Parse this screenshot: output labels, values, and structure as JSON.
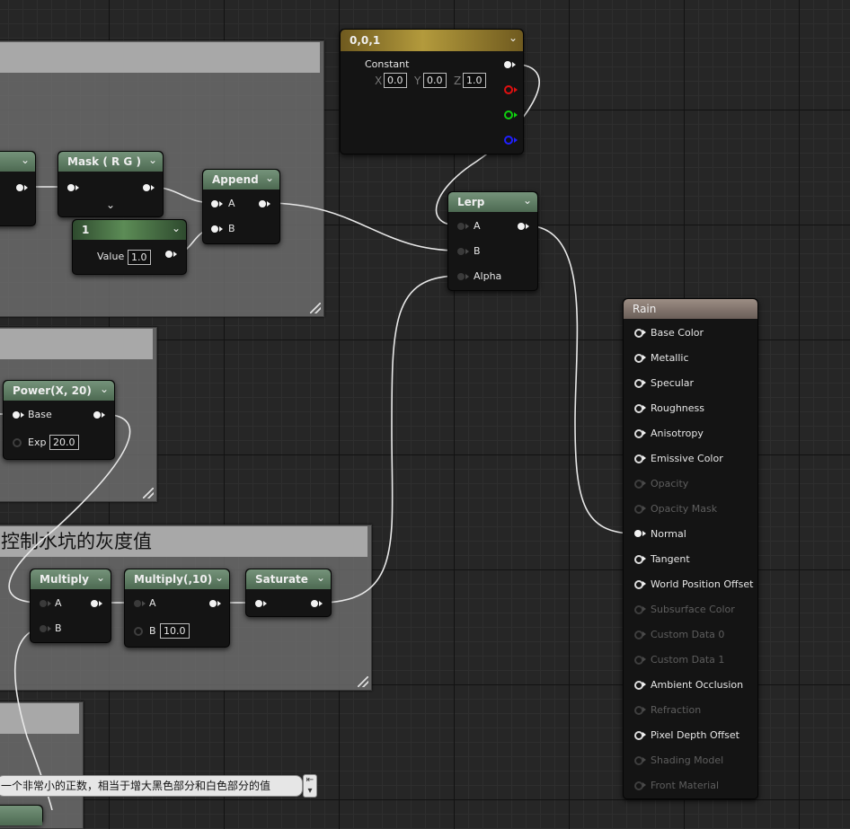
{
  "comments": {
    "c4_title": "控制水坑的灰度值"
  },
  "nodes": {
    "constant3": {
      "title": "0,0,1",
      "label": "Constant",
      "x_label": "X",
      "x_value": "0.0",
      "y_label": "Y",
      "y_value": "0.0",
      "z_label": "Z",
      "z_value": "1.0"
    },
    "mask": {
      "title": "Mask ( R G )"
    },
    "append": {
      "title": "Append",
      "pin_a": "A",
      "pin_b": "B"
    },
    "scalar1": {
      "title": "1",
      "value_label": "Value",
      "value": "1.0"
    },
    "lerp": {
      "title": "Lerp",
      "pin_a": "A",
      "pin_b": "B",
      "pin_alpha": "Alpha"
    },
    "power": {
      "title": "Power(X, 20)",
      "pin_base": "Base",
      "pin_exp": "Exp",
      "exp_value": "20.0"
    },
    "multiply1": {
      "title": "Multiply",
      "pin_a": "A",
      "pin_b": "B"
    },
    "multiply2": {
      "title": "Multiply(,10)",
      "pin_a": "A",
      "pin_b": "B",
      "b_value": "10.0"
    },
    "saturate": {
      "title": "Saturate"
    },
    "rain": {
      "title": "Rain",
      "pins": [
        {
          "label": "Base Color",
          "active": true
        },
        {
          "label": "Metallic",
          "active": true
        },
        {
          "label": "Specular",
          "active": true
        },
        {
          "label": "Roughness",
          "active": true
        },
        {
          "label": "Anisotropy",
          "active": true
        },
        {
          "label": "Emissive Color",
          "active": true
        },
        {
          "label": "Opacity",
          "active": false
        },
        {
          "label": "Opacity Mask",
          "active": false
        },
        {
          "label": "Normal",
          "active": true
        },
        {
          "label": "Tangent",
          "active": true
        },
        {
          "label": "World Position Offset",
          "active": true
        },
        {
          "label": "Subsurface Color",
          "active": false
        },
        {
          "label": "Custom Data 0",
          "active": false
        },
        {
          "label": "Custom Data 1",
          "active": false
        },
        {
          "label": "Ambient Occlusion",
          "active": true
        },
        {
          "label": "Refraction",
          "active": false
        },
        {
          "label": "Pixel Depth Offset",
          "active": true
        },
        {
          "label": "Shading Model",
          "active": false
        },
        {
          "label": "Front Material",
          "active": false
        }
      ]
    }
  },
  "note": {
    "text": "一个非常小的正数，相当于增大黑色部分和白色部分的值"
  },
  "colors": {
    "graph_bg": "#262626",
    "comment_bg": "#6e6e6e",
    "node_bg": "#141414",
    "header_green": "#5c7a60",
    "header_gold": "#b39a3c",
    "header_brown": "#8a7d75",
    "wire": "#e8e8e8"
  }
}
